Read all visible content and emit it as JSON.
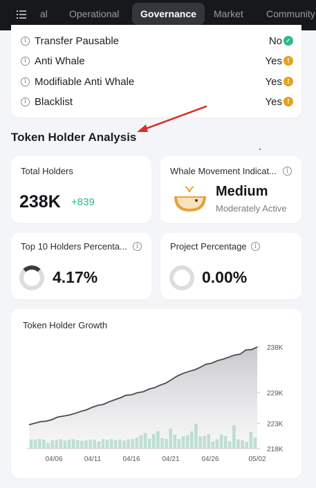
{
  "nav": {
    "tabs": [
      "al",
      "Operational",
      "Governance",
      "Market",
      "Community"
    ],
    "active": "Governance"
  },
  "audit": {
    "rows": [
      {
        "label": "Transfer Pausable",
        "value": "No",
        "status": "check",
        "color": "#2eb887"
      },
      {
        "label": "Anti Whale",
        "value": "Yes",
        "status": "warning",
        "color": "#e6a21a"
      },
      {
        "label": "Modifiable Anti Whale",
        "value": "Yes",
        "status": "warning",
        "color": "#e6a21a"
      },
      {
        "label": "Blacklist",
        "value": "Yes",
        "status": "warning",
        "color": "#e6a21a"
      }
    ]
  },
  "section": {
    "title": "Token Holder Analysis"
  },
  "total_holders": {
    "label": "Total Holders",
    "value": "238K",
    "delta": "+839"
  },
  "whale": {
    "label": "Whale Movement Indicat...",
    "level": "Medium",
    "sub": "Moderately Active"
  },
  "top10": {
    "label": "Top 10 Holders Percenta...",
    "value": "4.17%"
  },
  "project": {
    "label": "Project Percentage",
    "value": "0.00%"
  },
  "chart_data": {
    "type": "line",
    "title": "Token Holder Growth",
    "x_ticks": [
      "04/06",
      "04/11",
      "04/16",
      "04/21",
      "04/26",
      "05/02"
    ],
    "y_ticks": [
      "238K",
      "229K",
      "223K",
      "218K"
    ],
    "y_tick_values": [
      238000,
      229000,
      223000,
      218000
    ],
    "ylim": [
      218000,
      238000
    ],
    "series": [
      {
        "values": [
          222700,
          223000,
          223300,
          223400,
          223700,
          224200,
          224400,
          224600,
          224900,
          225300,
          225600,
          226100,
          226500,
          226700,
          227200,
          227600,
          228000,
          228500,
          228600,
          229000,
          229200,
          229700,
          230000,
          230500,
          230900,
          231600,
          232300,
          232800,
          233200,
          233500,
          234000,
          234600,
          234800,
          235300,
          235600,
          236000,
          236400,
          236600,
          237400,
          237500,
          238000
        ]
      }
    ],
    "bars": [
      93,
      93,
      98,
      93,
      58,
      85,
      90,
      96,
      83,
      93,
      96,
      85,
      79,
      87,
      93,
      89,
      74,
      98,
      91,
      97,
      86,
      91,
      82,
      93,
      97,
      112,
      136,
      159,
      102,
      148,
      179,
      108,
      100,
      206,
      143,
      101,
      125,
      137,
      176,
      255,
      124,
      129,
      147,
      72,
      96,
      145,
      127,
      74,
      239,
      94,
      85,
      69,
      171,
      113
    ]
  }
}
